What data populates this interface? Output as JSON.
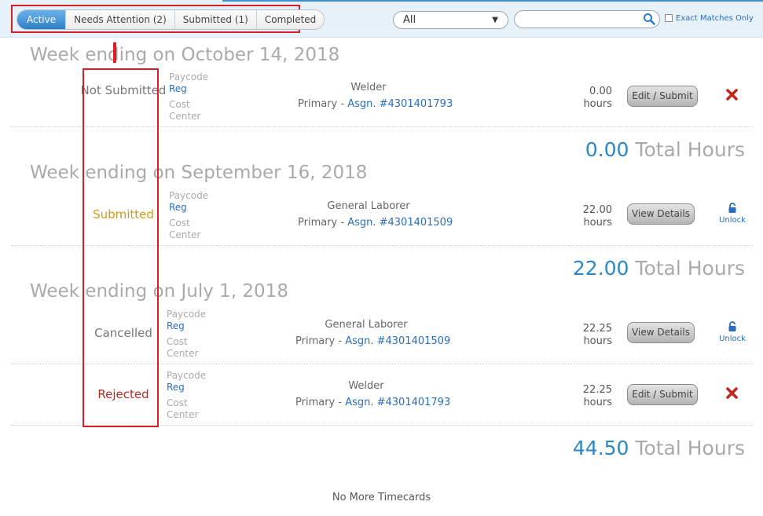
{
  "header": {
    "tabs": [
      {
        "label": "Active",
        "active": true
      },
      {
        "label": "Needs Attention (2)",
        "active": false
      },
      {
        "label": "Submitted (1)",
        "active": false
      },
      {
        "label": "Completed",
        "active": false
      }
    ],
    "filter_select": {
      "value": "All"
    },
    "search": {
      "value": "",
      "placeholder": ""
    },
    "exact_matches": {
      "label": "Exact Matches Only",
      "checked": false
    }
  },
  "weeks": [
    {
      "title": "Week ending on October 14, 2018",
      "timecards": [
        {
          "status": "Not Submitted",
          "status_color": "#777777",
          "paycode_label": "Paycode",
          "paycode": "Reg",
          "cost_center_label": "Cost Center",
          "job": "Welder",
          "assignment_prefix": "Primary - ",
          "assignment": "Asgn. #4301401793",
          "hours_value": "0.00",
          "hours_unit": "hours",
          "action": "Edit / Submit",
          "secondary": "delete-icon"
        }
      ],
      "total": {
        "value": "0.00",
        "label": "Total Hours"
      }
    },
    {
      "title": "Week ending on September 16, 2018",
      "timecards": [
        {
          "status": "Submitted",
          "status_color": "#d09a17",
          "paycode_label": "Paycode",
          "paycode": "Reg",
          "cost_center_label": "Cost Center",
          "job": "General Laborer",
          "assignment_prefix": "Primary - ",
          "assignment": "Asgn. #4301401509",
          "hours_value": "22.00",
          "hours_unit": "hours",
          "action": "View Details",
          "secondary": "unlock",
          "secondary_label": "Unlock"
        }
      ],
      "total": {
        "value": "22.00",
        "label": "Total Hours"
      }
    },
    {
      "title": "Week ending on July 1, 2018",
      "timecards": [
        {
          "status": "Cancelled",
          "status_color": "#777777",
          "paycode_label": "Paycode",
          "paycode": "Reg",
          "cost_center_label": "Cost Center",
          "job": "General Laborer",
          "assignment_prefix": "Primary - ",
          "assignment": "Asgn. #4301401509",
          "hours_value": "22.25",
          "hours_unit": "hours",
          "action": "View Details",
          "secondary": "unlock",
          "secondary_label": "Unlock"
        },
        {
          "status": "Rejected",
          "status_color": "#b22a20",
          "paycode_label": "Paycode",
          "paycode": "Reg",
          "cost_center_label": "Cost Center",
          "job": "Welder",
          "assignment_prefix": "Primary - ",
          "assignment": "Asgn. #4301401793",
          "hours_value": "22.25",
          "hours_unit": "hours",
          "action": "Edit / Submit",
          "secondary": "delete-icon"
        }
      ],
      "total": {
        "value": "44.50",
        "label": "Total Hours"
      }
    }
  ],
  "footer": {
    "text": "No More Timecards"
  },
  "colors": {
    "accent": "#2a88c8",
    "link": "#2a6ebb",
    "highlight": "#d62027",
    "delete": "#c0281c"
  }
}
